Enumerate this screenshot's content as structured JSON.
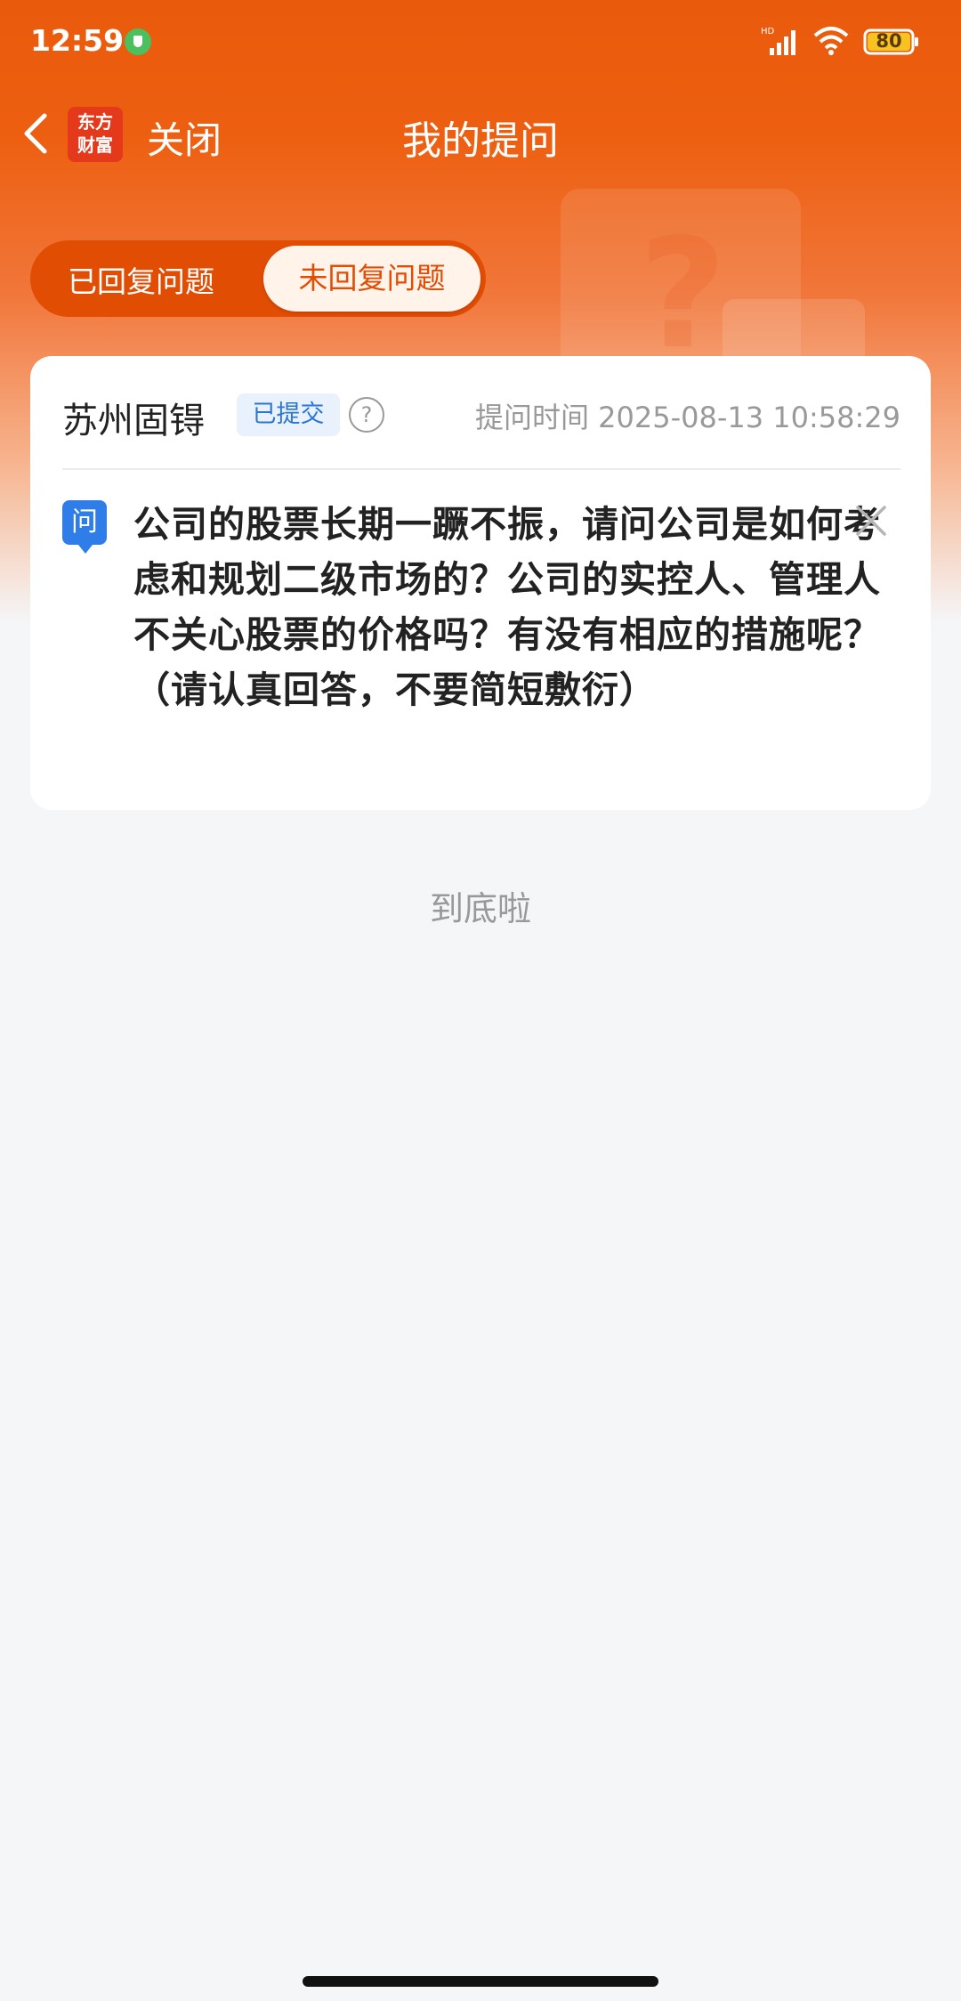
{
  "status_bar": {
    "time": "12:59",
    "network": "HD",
    "battery": "80"
  },
  "nav": {
    "logo_line1": "东方",
    "logo_line2": "财富",
    "close_label": "关闭",
    "title": "我的提问"
  },
  "tabs": {
    "answered": "已回复问题",
    "unanswered": "未回复问题",
    "active": "unanswered"
  },
  "card": {
    "company": "苏州固锝",
    "status": "已提交",
    "time_label": "提问时间 2025-08-13 10:58:29",
    "question_badge": "问",
    "question": "公司的股票长期一蹶不振，请问公司是如何考虑和规划二级市场的？公司的实控人、管理人不关心股票的价格吗？有没有相应的措施呢？（请认真回答，不要简短敷衍）"
  },
  "end_text": "到底啦",
  "colors": {
    "brand_orange": "#EA5A0C",
    "badge_blue": "#2E7DE8"
  }
}
